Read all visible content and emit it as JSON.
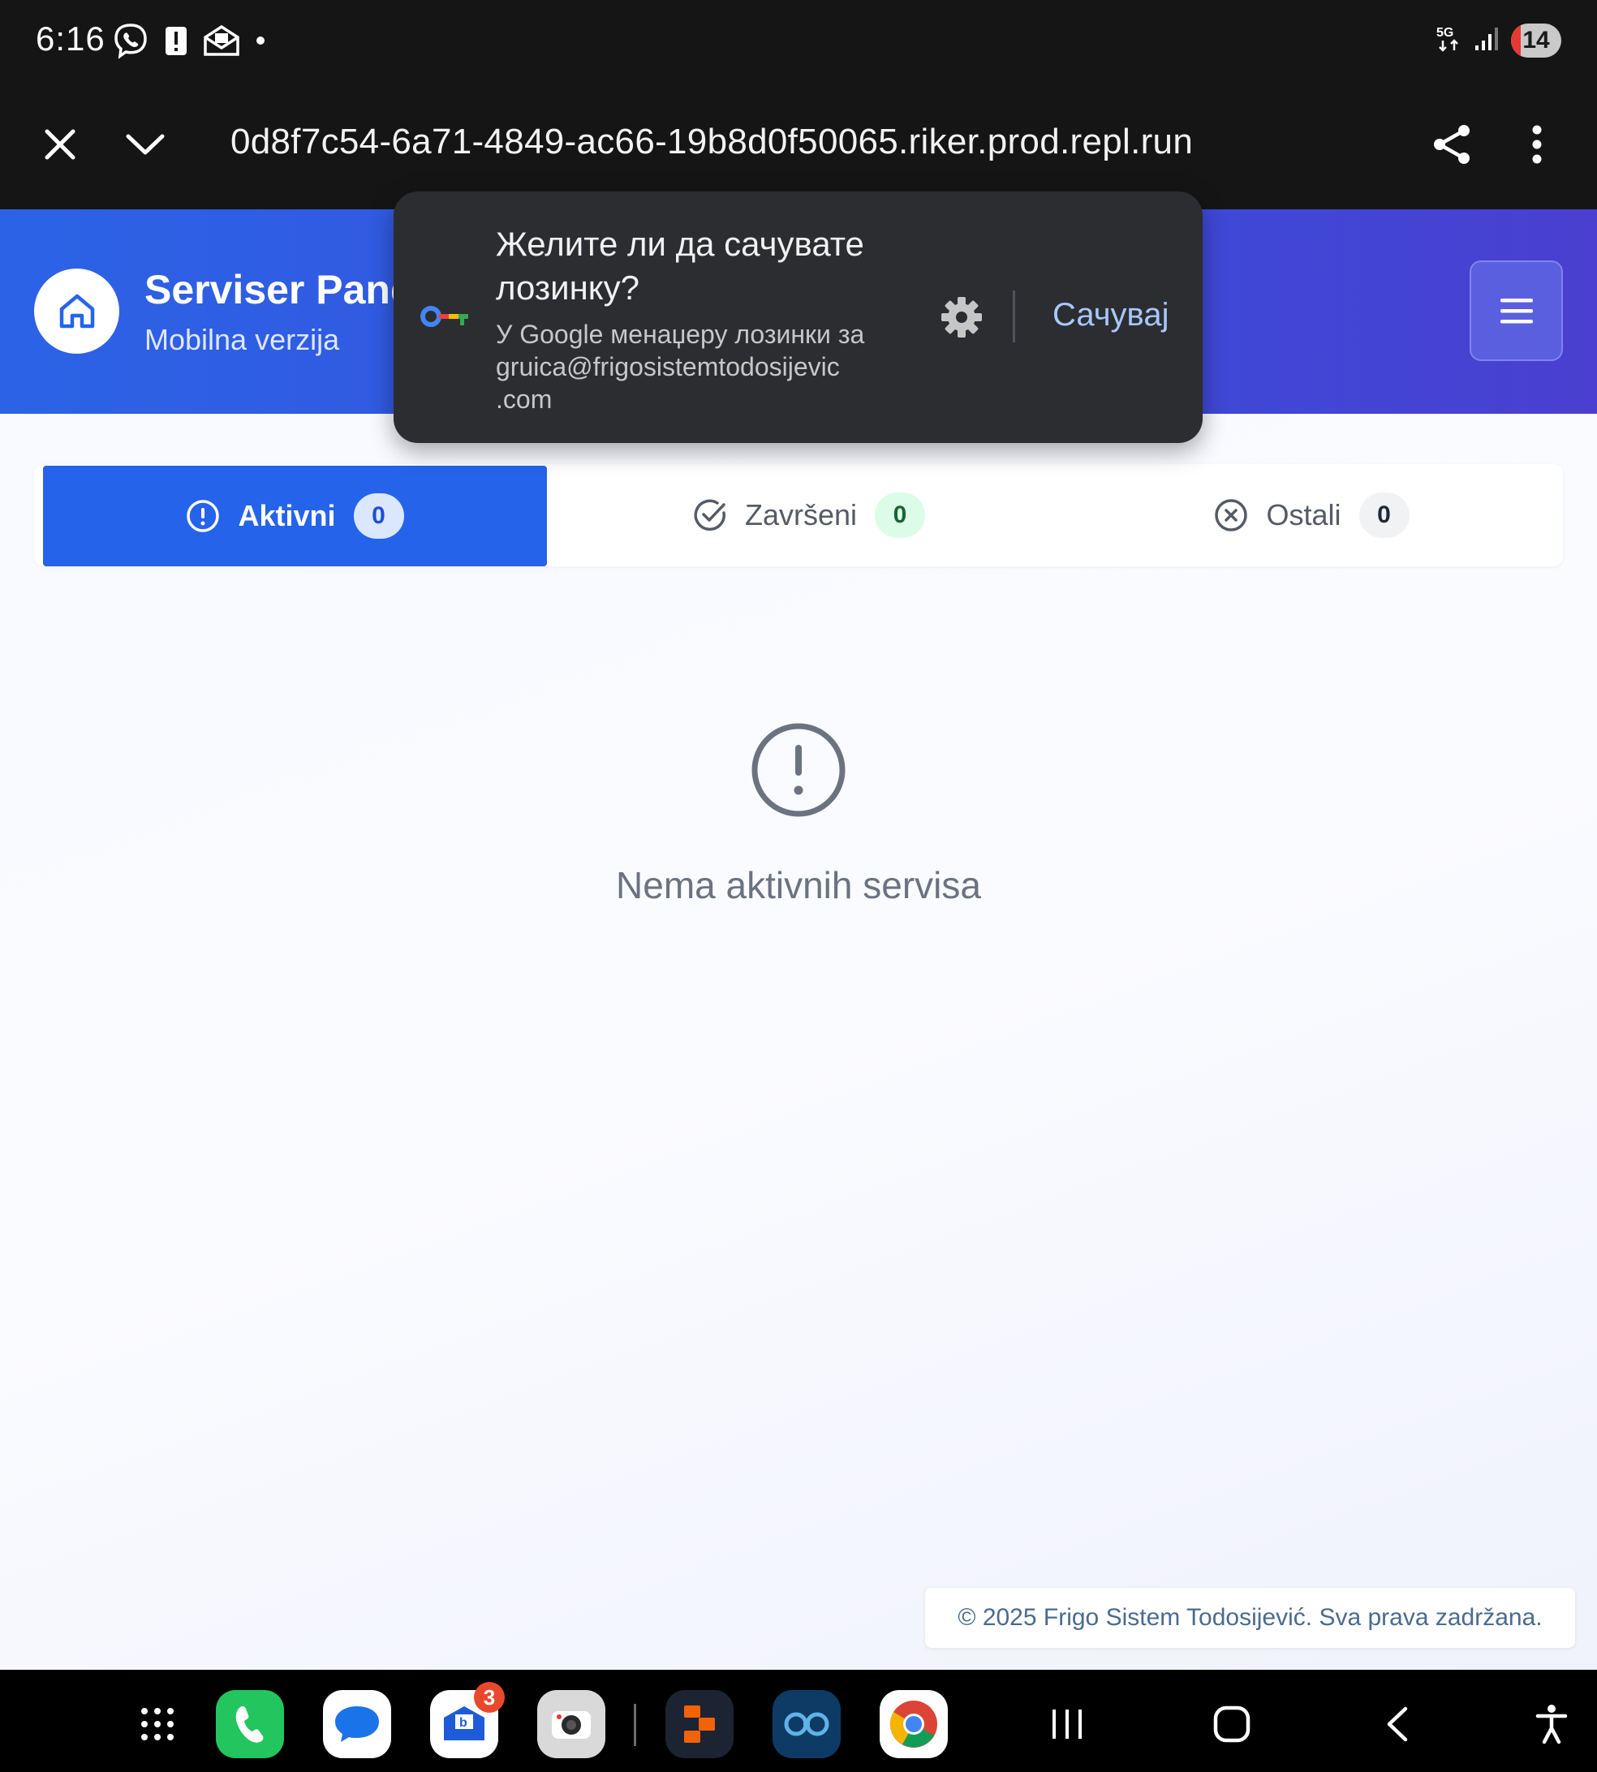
{
  "status_bar": {
    "time": "6:16",
    "network": "5G",
    "battery": "14"
  },
  "browser": {
    "url": "0d8f7c54-6a71-4849-ac66-19b8d0f50065.riker.prod.repl.run"
  },
  "header": {
    "title": "Serviser Panel",
    "subtitle": "Mobilna verzija"
  },
  "password_popup": {
    "title": "Желите ли да сачувате лозинку?",
    "subtitle": "У Google менаџеру лозинки за gruica@frigosistemtodosijevic .com",
    "save_label": "Сачувај"
  },
  "tabs": [
    {
      "label": "Aktivni",
      "count": "0"
    },
    {
      "label": "Završeni",
      "count": "0"
    },
    {
      "label": "Ostali",
      "count": "0"
    }
  ],
  "empty_state": {
    "message": "Nema aktivnih servisa"
  },
  "footer": {
    "copyright": "© 2025 Frigo Sistem Todosijević. Sva prava zadržana."
  },
  "taskbar": {
    "mail_badge": "3",
    "apps": [
      "app-drawer-icon",
      "phone-icon",
      "messages-icon",
      "mail-icon",
      "camera-icon",
      "replit-icon",
      "binoculars-app-icon",
      "chrome-icon"
    ]
  },
  "colors": {
    "primary": "#2563eb",
    "header_gradient_start": "#2c63e6",
    "header_gradient_end": "#4a3fd0",
    "popup_bg": "#2b2d31",
    "popup_accent": "#a8c7fa"
  }
}
